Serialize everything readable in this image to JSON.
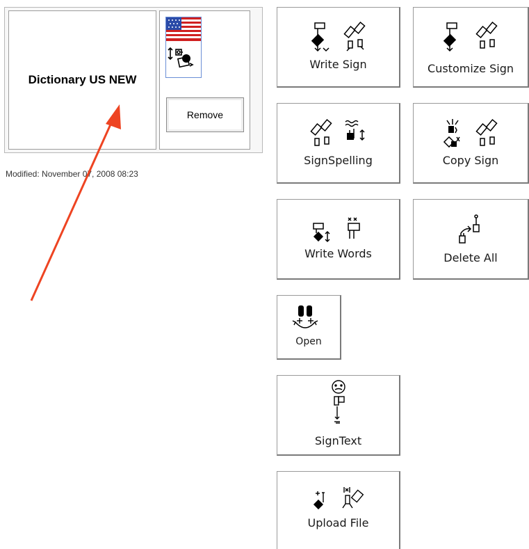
{
  "dictionary": {
    "title": "Dictionary US NEW",
    "remove_label": "Remove",
    "modified_text": "Modified: November 07, 2008 08:23",
    "flag_icon": "us-flag-icon",
    "sign_icon": "sign-symbol-icon"
  },
  "actions": {
    "write_sign": "Write Sign",
    "customize_sign": "Customize Sign",
    "signspelling": "SignSpelling",
    "copy_sign": "Copy Sign",
    "write_words": "Write Words",
    "delete_all": "Delete All",
    "open": "Open",
    "signtext": "SignText",
    "upload_file": "Upload File"
  },
  "annotation": {
    "arrow_color": "#ee4422"
  }
}
